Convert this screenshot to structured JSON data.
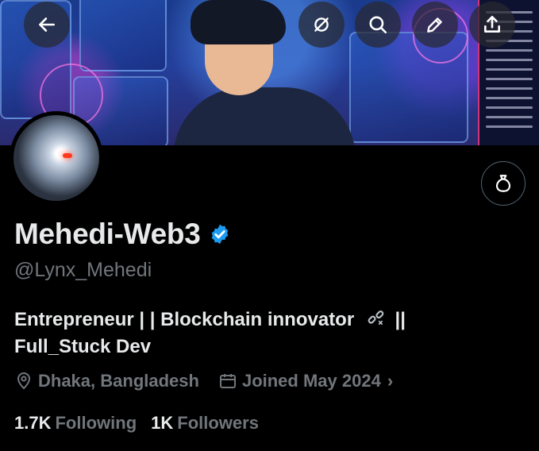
{
  "header": {
    "back_icon": "arrow-left-icon",
    "actions": [
      "grok-icon",
      "search-icon",
      "edit-pencil-icon",
      "share-upload-icon"
    ]
  },
  "profile": {
    "display_name": "Mehedi-Web3",
    "verified_icon": "verified-badge-icon",
    "verified_color": "#1d9bf0",
    "handle": "@Lynx_Mehedi",
    "bio_line1": "Entrepreneur | | Blockchain innovator",
    "bio_line1_suffix": "||",
    "bio_line2": "Full_Stuck Dev",
    "location": "Dhaka, Bangladesh",
    "joined": "Joined May 2024",
    "following_count": "1.7K",
    "following_label": "Following",
    "followers_count": "1K",
    "followers_label": "Followers"
  },
  "wallet_button_icon": "money-bag-icon"
}
